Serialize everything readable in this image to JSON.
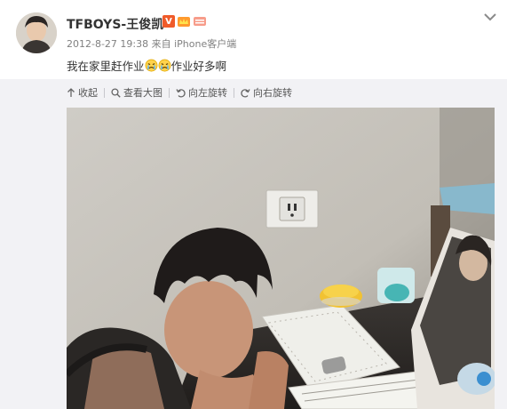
{
  "post": {
    "username": "TFBOYS-王俊凯",
    "meta": "2012-8-27 19:38 来自 iPhone客户端",
    "text_before": "我在家里赶作业",
    "text_after": "作业好多啊"
  },
  "toolbar": {
    "collapse": "收起",
    "view_large": "查看大图",
    "rotate_left": "向左旋转",
    "rotate_right": "向右旋转"
  },
  "icons": {
    "verified": "V",
    "collapse": "collapse-up-icon",
    "magnifier": "magnifier-icon",
    "rotate_left": "rotate-left-icon",
    "rotate_right": "rotate-right-icon",
    "options": "chevron-down-icon"
  },
  "colors": {
    "verified_badge": "#f05b2a",
    "meta_text": "#808080",
    "media_background": "#f2f2f5"
  }
}
